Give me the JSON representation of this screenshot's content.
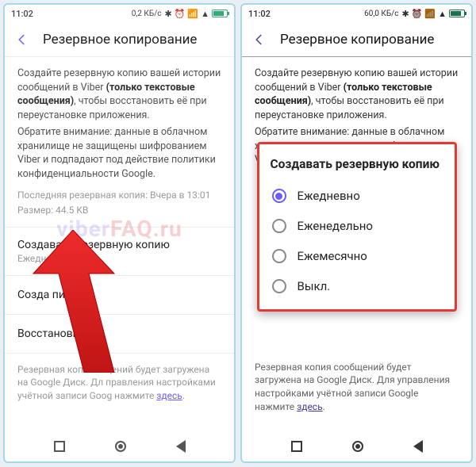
{
  "left": {
    "status": {
      "time": "11:02",
      "speed": "0,2 КБ/с"
    },
    "header": {
      "title": "Резервное копирование"
    },
    "desc_prefix": "Создайте резервную копию вашей истории сообщений в Viber ",
    "desc_bold": "(только текстовые сообщения)",
    "desc_suffix": ", чтобы восстановить её при переустановке приложения.",
    "desc2": "Обратите внимание: данные в облачном хранилище не защищены шифрованием Viber и подпадают под действие политики конфиденциальности Google.",
    "last_backup": "Последняя резервная копия: Вчера в 13:01",
    "size": "Размер: 44.5 KB",
    "row_backup_title": "Создавать резервную копию",
    "row_backup_sub": "Ежедневно",
    "row_create": "Созда         пию",
    "row_restore": "Восстанови",
    "footer_prefix": "Резервная копия с        щений будет загружена на Google Диск. Дл     правления настройками учётной записи Goog    нажмите ",
    "footer_link": "здесь",
    "footer_suffix": "."
  },
  "right": {
    "status": {
      "time": "11:02",
      "speed": "60,0 КБ/с"
    },
    "header": {
      "title": "Резервное копирование"
    },
    "desc_prefix": "Создайте резервную копию вашей истории сообщений в Viber ",
    "desc_bold": "(только текстовые сообщения)",
    "desc_suffix": ", чтобы восстановить её при переустановке приложения.",
    "desc2": "Обратите внимание: данные в облачном хранилище не защищены шифрованием Viber и подпадают под действие политики",
    "footer_prefix": "Резервная копия сообщений будет загружена на Google Диск. Для управления настройками учётной записи Google нажмите ",
    "footer_link": "здесь",
    "footer_suffix": ".",
    "dialog": {
      "title": "Создавать резервную копию",
      "options": [
        "Ежедневно",
        "Еженедельно",
        "Ежемесячно",
        "Выкл."
      ],
      "selected": 0
    }
  },
  "watermark_prefix": "viber",
  "watermark_suffix": "FAQ.ru"
}
